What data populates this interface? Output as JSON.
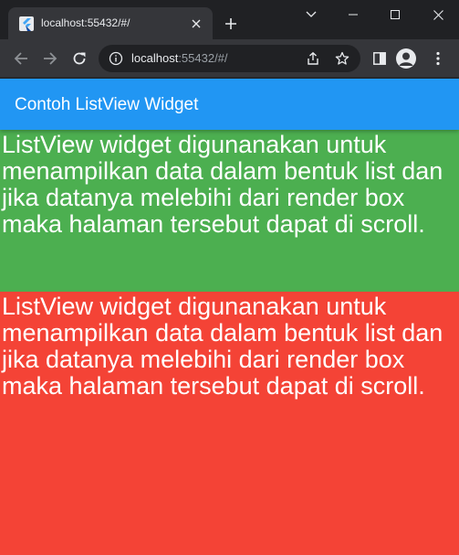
{
  "browser": {
    "tab": {
      "title": "localhost:55432/#/",
      "favicon": "flutter-icon"
    },
    "address": {
      "host": "localhost",
      "rest": ":55432/#/"
    },
    "icons": {
      "back": "back-arrow-icon",
      "forward": "forward-arrow-icon",
      "reload": "reload-icon",
      "info": "info-icon",
      "share": "share-icon",
      "bookmark": "star-icon",
      "side_panel": "side-panel-icon",
      "profile": "profile-avatar-icon",
      "menu": "kebab-menu-icon",
      "new_tab": "plus-icon",
      "close_tab": "close-icon",
      "tab_search": "chevron-down-icon",
      "minimize": "minimize-icon",
      "maximize": "maximize-icon",
      "close_window": "close-icon"
    },
    "colors": {
      "frame": "#202124",
      "toolbar": "#35363a",
      "omnibox": "#202124"
    }
  },
  "app": {
    "appbar": {
      "title": "Contoh ListView Widget",
      "color": "#2196f3"
    },
    "list_items": [
      {
        "text": "ListView widget digunanakan untuk menampilkan data dalam bentuk list dan jika datanya melebihi dari render box maka halaman tersebut dapat di scroll.",
        "color": "#4caf50"
      },
      {
        "text": "ListView widget digunanakan untuk menampilkan data dalam bentuk list dan jika datanya melebihi dari render box maka halaman tersebut dapat di scroll.",
        "color": "#f44336"
      }
    ]
  }
}
